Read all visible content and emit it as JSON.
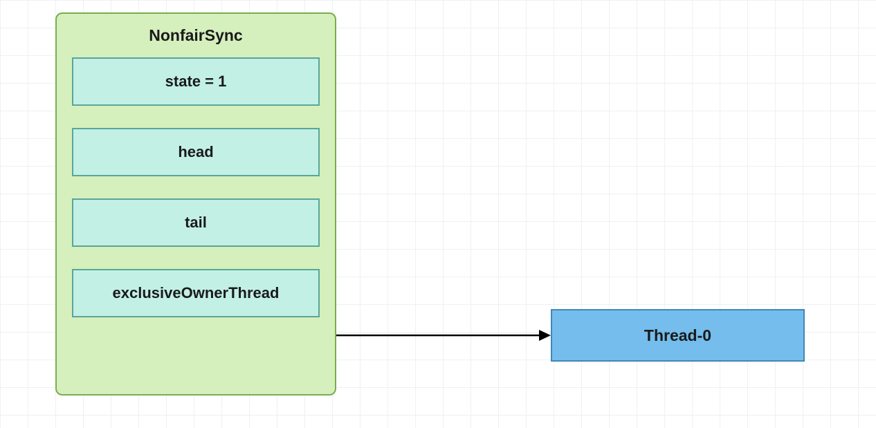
{
  "sync": {
    "title": "NonfairSync",
    "fields": {
      "state": "state = 1",
      "head": "head",
      "tail": "tail",
      "exclusiveOwnerThread": "exclusiveOwnerThread"
    }
  },
  "thread": {
    "label": "Thread-0"
  }
}
